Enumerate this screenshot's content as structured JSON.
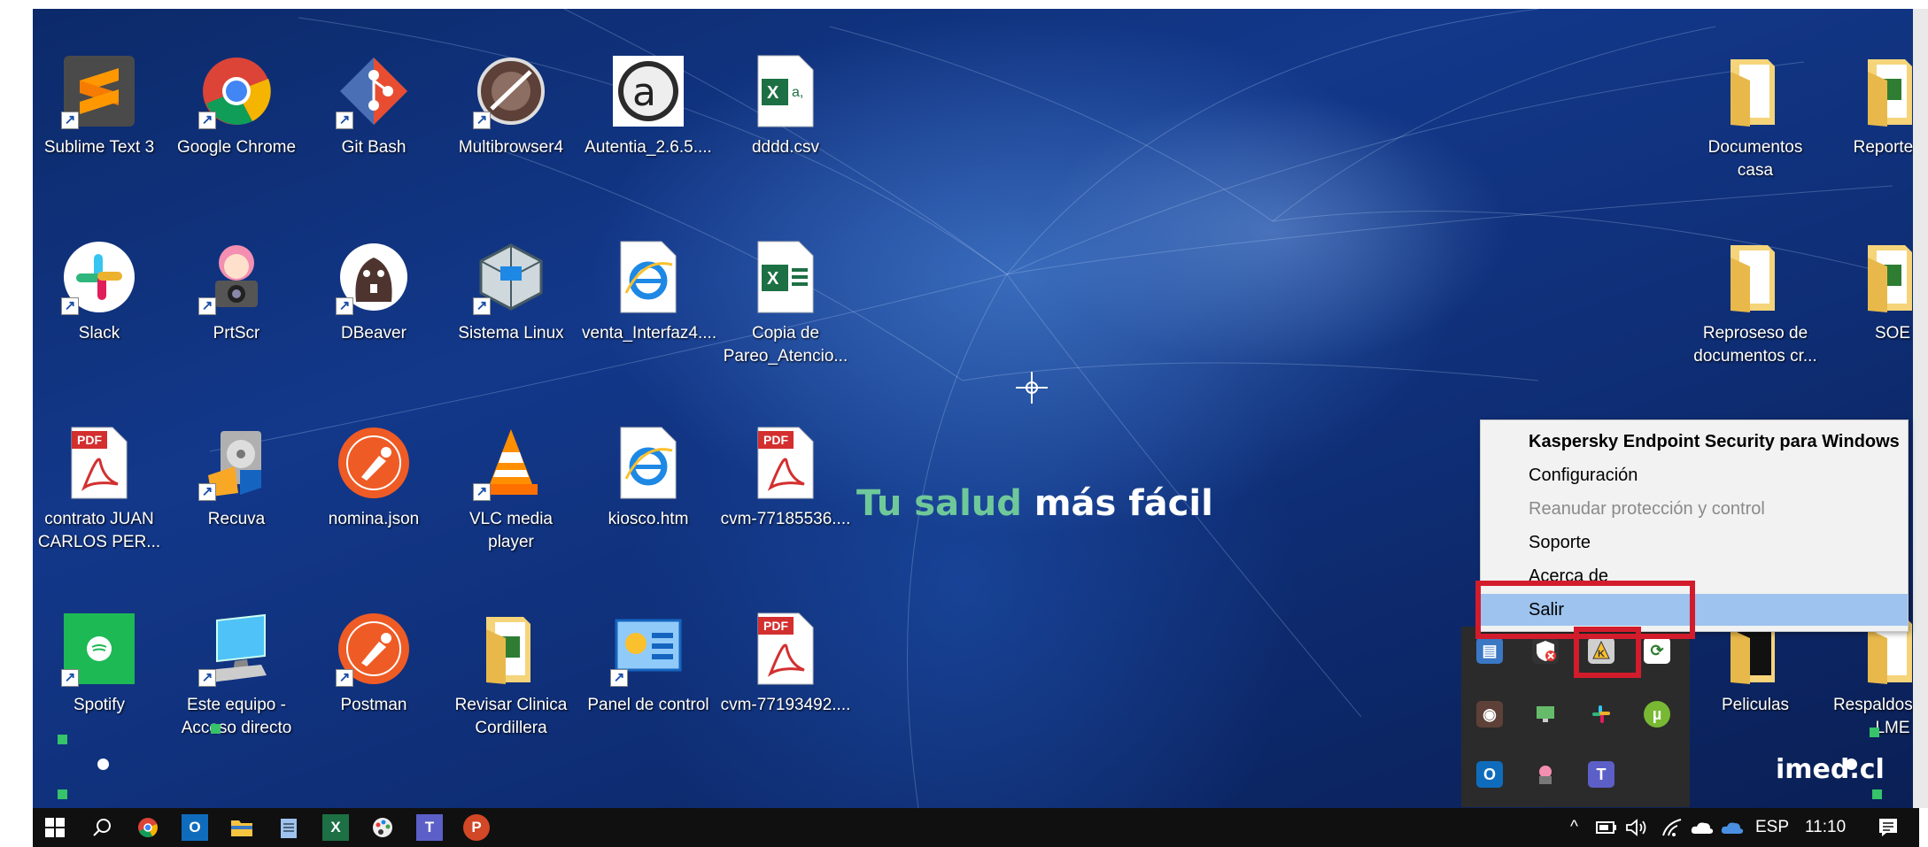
{
  "desktop": {
    "icons": [
      {
        "label": "Sublime Text 3",
        "icon": "sublime-icon"
      },
      {
        "label": "Google Chrome",
        "icon": "chrome-icon"
      },
      {
        "label": "Git Bash",
        "icon": "git-bash-icon"
      },
      {
        "label": "Multibrowser4",
        "icon": "multibrowser-icon"
      },
      {
        "label": "Autentia_2.6.5....",
        "icon": "autentia-icon"
      },
      {
        "label": "dddd.csv",
        "icon": "excel-file-icon"
      },
      {
        "label": "Slack",
        "icon": "slack-icon"
      },
      {
        "label": "PrtScr",
        "icon": "prtscr-icon"
      },
      {
        "label": "DBeaver",
        "icon": "dbeaver-icon"
      },
      {
        "label": "Sistema Linux",
        "icon": "virtualbox-icon"
      },
      {
        "label": "venta_Interfaz4....",
        "icon": "ie-file-icon"
      },
      {
        "label": "Copia de Pareo_Atencio...",
        "icon": "excel-file-icon"
      },
      {
        "label": "contrato JUAN CARLOS PER...",
        "icon": "pdf-icon"
      },
      {
        "label": "Recuva",
        "icon": "recuva-icon"
      },
      {
        "label": "nomina.json",
        "icon": "postman-icon"
      },
      {
        "label": "VLC media player",
        "icon": "vlc-icon"
      },
      {
        "label": "kiosco.htm",
        "icon": "ie-file-icon"
      },
      {
        "label": "cvm-77185536....",
        "icon": "pdf-icon"
      },
      {
        "label": "Spotify",
        "icon": "spotify-icon"
      },
      {
        "label": "Este equipo - Acceso directo",
        "icon": "computer-icon"
      },
      {
        "label": "Postman",
        "icon": "postman-icon"
      },
      {
        "label": "Revisar Clinica Cordillera",
        "icon": "folder-icon"
      },
      {
        "label": "Panel de control",
        "icon": "control-panel-icon"
      },
      {
        "label": "cvm-77193492....",
        "icon": "pdf-icon"
      },
      {
        "label": "Documentos casa",
        "icon": "folder-icon"
      },
      {
        "label": "Reporteria",
        "icon": "folder-icon"
      },
      {
        "label": "Reproseso de documentos cr...",
        "icon": "folder-icon"
      },
      {
        "label": "SOE",
        "icon": "folder-icon"
      },
      {
        "label": "Peliculas",
        "icon": "folder-icon"
      },
      {
        "label": "Respaldos XML LME",
        "icon": "folder-icon"
      }
    ],
    "wallpaper_slogan_green": "Tu salud",
    "wallpaper_slogan_white": " más fácil",
    "wallpaper_brand": "imed.cl"
  },
  "context_menu": {
    "items": [
      {
        "label": "Kaspersky Endpoint Security para Windows",
        "style": "bold"
      },
      {
        "label": "Configuración",
        "style": "normal"
      },
      {
        "label": "Reanudar protección y control",
        "style": "disabled"
      },
      {
        "label": "Soporte",
        "style": "normal"
      },
      {
        "label": "Acerca de",
        "style": "normal"
      },
      {
        "label": "Salir",
        "style": "hover"
      }
    ],
    "highlight_color": "#d21c2c"
  },
  "tray_popup": {
    "icons": [
      "network-adapter-icon",
      "kaspersky-blocked-icon",
      "kaspersky-icon",
      "document-sync-icon",
      "vpn-globe-icon",
      "display-icon",
      "slack-tray-icon",
      "utorrent-icon",
      "outlook-tray-icon",
      "greenshot-icon",
      "teams-tray-icon"
    ]
  },
  "taskbar": {
    "apps": [
      "windows-start-icon",
      "search-icon",
      "chrome-icon",
      "outlook-icon",
      "file-explorer-icon",
      "notepad-icon",
      "excel-icon",
      "paint-icon",
      "teams-icon",
      "powerpoint-icon"
    ],
    "tray_chevron": "^",
    "language": "ESP",
    "time": "11:10"
  }
}
